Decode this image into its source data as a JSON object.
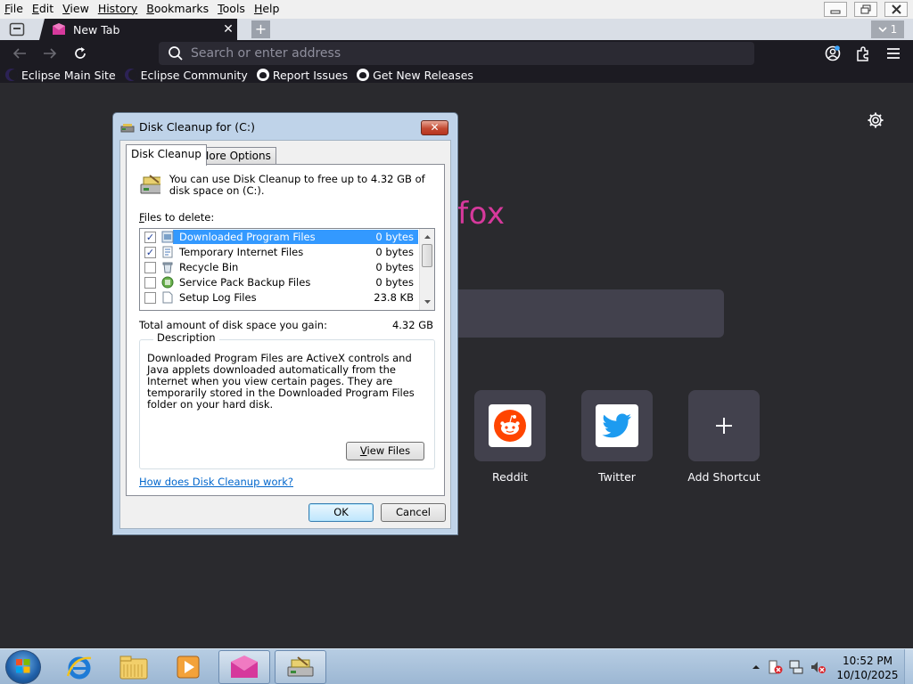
{
  "browser": {
    "menu": [
      {
        "key": "F",
        "rest": "ile"
      },
      {
        "key": "E",
        "rest": "dit"
      },
      {
        "key": "V",
        "rest": "iew"
      },
      {
        "key": "",
        "rest": "History",
        "hist": true
      },
      {
        "key": "B",
        "rest": "ookmarks"
      },
      {
        "key": "T",
        "rest": "ools"
      },
      {
        "key": "H",
        "rest": "elp"
      }
    ],
    "tab_title": "New Tab",
    "tab_count": "1",
    "url_placeholder": "Search or enter address",
    "bookmarks": [
      {
        "label": "Eclipse Main Site",
        "icon": "eclipse-icon"
      },
      {
        "label": "Eclipse Community",
        "icon": "eclipse-icon"
      },
      {
        "label": "Report Issues",
        "icon": "github-icon"
      },
      {
        "label": "Get New Releases",
        "icon": "github-icon"
      }
    ]
  },
  "newtab": {
    "logo_partial": "smafox",
    "shortcuts": [
      {
        "label": "Reddit",
        "icon": "reddit-icon"
      },
      {
        "label": "Twitter",
        "icon": "twitter-icon"
      },
      {
        "label": "Add Shortcut",
        "icon": "plus-icon"
      }
    ]
  },
  "dialog": {
    "title": "Disk Cleanup for  (C:)",
    "tabs": [
      "Disk Cleanup",
      "More Options"
    ],
    "intro": "You can use Disk Cleanup to free up to 4.32 GB of disk space on  (C:).",
    "files_label_key": "F",
    "files_label_rest": "iles to delete:",
    "files": [
      {
        "name": "Downloaded Program Files",
        "size": "0 bytes",
        "checked": true,
        "selected": true
      },
      {
        "name": "Temporary Internet Files",
        "size": "0 bytes",
        "checked": true,
        "selected": false
      },
      {
        "name": "Recycle Bin",
        "size": "0 bytes",
        "checked": false,
        "selected": false
      },
      {
        "name": "Service Pack Backup Files",
        "size": "0 bytes",
        "checked": false,
        "selected": false
      },
      {
        "name": "Setup Log Files",
        "size": "23.8 KB",
        "checked": false,
        "selected": false
      }
    ],
    "total_label": "Total amount of disk space you gain:",
    "total_value": "4.32 GB",
    "description_legend": "Description",
    "description_text": "Downloaded Program Files are ActiveX controls and Java applets downloaded automatically from the Internet when you view certain pages. They are temporarily stored in the Downloaded Program Files folder on your hard disk.",
    "view_files_key": "V",
    "view_files_rest": "iew Files",
    "help_link": "How does Disk Cleanup work?",
    "ok_label": "OK",
    "cancel_label": "Cancel"
  },
  "taskbar": {
    "time": "10:52 PM",
    "date": "10/10/2025",
    "items": [
      "internet-explorer-icon",
      "file-explorer-icon",
      "media-player-icon",
      "plasmafox-icon",
      "disk-cleanup-icon"
    ]
  }
}
